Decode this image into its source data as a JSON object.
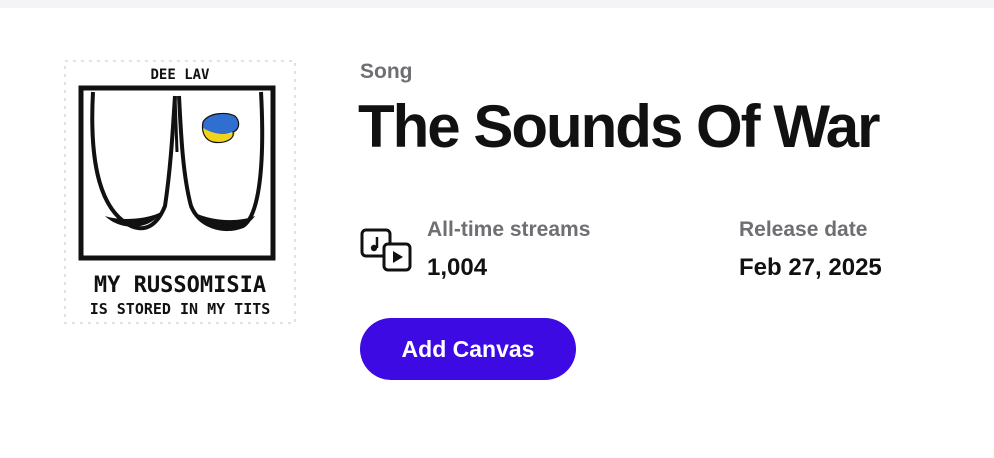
{
  "artwork": {
    "artist_text": "DEE LAV",
    "caption_line1": "MY RUSSOMISIA",
    "caption_line2": "IS STORED IN MY TITS"
  },
  "song": {
    "type_label": "Song",
    "title": "The Sounds Of War"
  },
  "stats": {
    "streams_label": "All-time streams",
    "streams_value": "1,004",
    "release_label": "Release date",
    "release_value": "Feb 27, 2025"
  },
  "actions": {
    "add_canvas_label": "Add Canvas"
  },
  "icons": {
    "streams_icon": "music-video-icon"
  },
  "colors": {
    "accent": "#3d0ae3",
    "muted_text": "#6e6e73",
    "primary_text": "#111111",
    "flag_blue": "#2f6fd0",
    "flag_yellow": "#f2d21b"
  }
}
